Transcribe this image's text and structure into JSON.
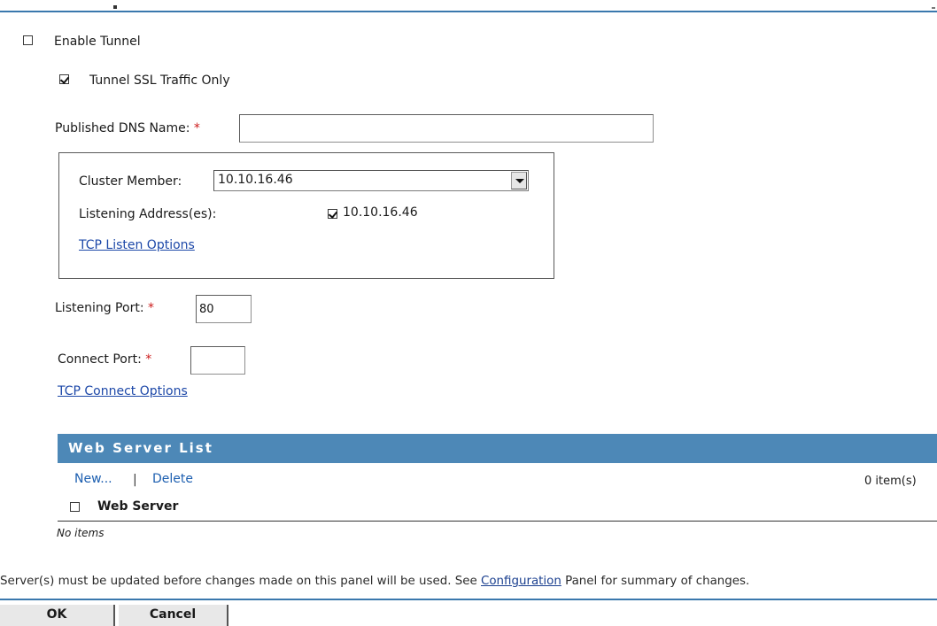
{
  "form": {
    "enable_tunnel_label": "Enable Tunnel",
    "enable_tunnel_checked": false,
    "tunnel_ssl_label": "Tunnel SSL Traffic Only",
    "tunnel_ssl_checked": true,
    "published_dns_label": "Published DNS Name:",
    "required_mark": "*",
    "published_dns_value": "",
    "cluster_member_label": "Cluster Member:",
    "cluster_member_value": "10.10.16.46",
    "listening_addresses_label": "Listening Address(es):",
    "listening_address_value": "10.10.16.46",
    "listening_address_checked": true,
    "tcp_listen_options_label": "TCP Listen Options",
    "listening_port_label": "Listening Port:",
    "listening_port_value": "80",
    "connect_port_label": "Connect Port:",
    "connect_port_value": "",
    "tcp_connect_options_label": "TCP Connect Options"
  },
  "web_server_list": {
    "title": "Web Server List",
    "new_label": "New...",
    "separator": "|",
    "delete_label": "Delete",
    "item_count": "0 item(s)",
    "column_header": "Web Server",
    "empty_text": "No items"
  },
  "footer": {
    "notice_prefix": "Server(s) must be updated before changes made on this panel will be used. See",
    "notice_link": "Configuration",
    "notice_suffix": "Panel for summary of changes.",
    "ok_label": "OK",
    "cancel_label": "Cancel"
  },
  "colors": {
    "accent": "#4d88b7",
    "rule": "#3a78ad",
    "link": "#1d48a8",
    "required": "#cc1b1b"
  }
}
